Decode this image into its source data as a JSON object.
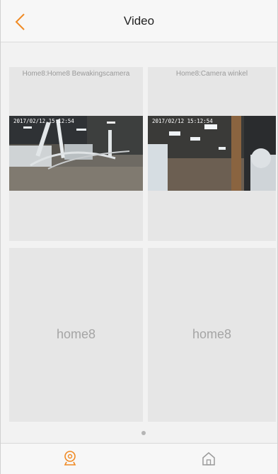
{
  "header": {
    "title": "Video"
  },
  "cameras": [
    {
      "label": "Home8:Home8 Bewakingscamera",
      "timestamp": "2017/02/12 15:12:54"
    },
    {
      "label": "Home8:Camera winkel",
      "timestamp": "2017/02/12 15:12:54"
    }
  ],
  "placeholders": [
    {
      "text": "home8"
    },
    {
      "text": "home8"
    }
  ],
  "colors": {
    "accent": "#f08a24",
    "tile": "#e6e6e6"
  },
  "tabs": [
    {
      "icon": "camera-icon",
      "active": true
    },
    {
      "icon": "home-icon",
      "active": false
    }
  ]
}
